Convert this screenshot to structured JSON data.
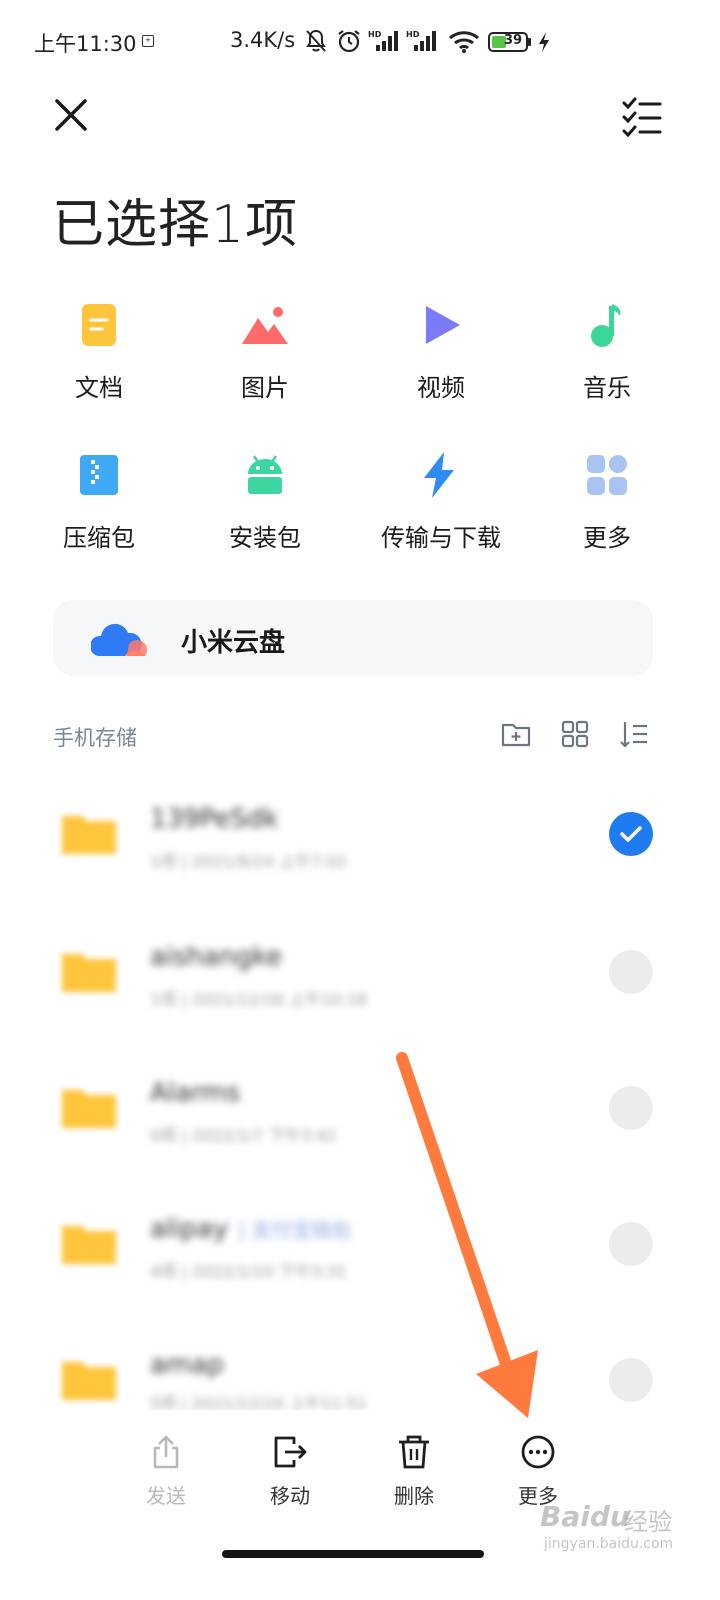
{
  "status_bar": {
    "time": "上午11:30",
    "net_speed": "3.4K/s",
    "battery": "39"
  },
  "header": {
    "title": "已选择1项"
  },
  "categories": [
    {
      "label": "文档",
      "icon": "document-icon",
      "color": "#FFC53D"
    },
    {
      "label": "图片",
      "icon": "image-icon",
      "color": "#FF6B6B"
    },
    {
      "label": "视频",
      "icon": "video-play-icon",
      "color": "#7B7BF7"
    },
    {
      "label": "音乐",
      "icon": "music-note-icon",
      "color": "#3DD598"
    },
    {
      "label": "压缩包",
      "icon": "zip-icon",
      "color": "#3FA9F5"
    },
    {
      "label": "安装包",
      "icon": "android-icon",
      "color": "#3DD5A0"
    },
    {
      "label": "传输与下载",
      "icon": "transfer-icon",
      "color": "#2F8BF5"
    },
    {
      "label": "更多",
      "icon": "grid-icon",
      "color": "#A9C3F2"
    }
  ],
  "cloud": {
    "label": "小米云盘",
    "icon": "cloud-icon"
  },
  "storage": {
    "header": "手机存储",
    "icons": [
      "new-folder-icon",
      "grid-view-icon",
      "sort-icon"
    ]
  },
  "files": [
    {
      "name": "139PeSdk",
      "meta": "1项 | 2021/8/24 上午7:02",
      "tag": "",
      "selected": true
    },
    {
      "name": "aishangke",
      "meta": "1项 | 2021/12/16 上午10:18",
      "tag": "",
      "selected": false
    },
    {
      "name": "Alarms",
      "meta": "0项 | 2022/1/7 下午3:42",
      "tag": "",
      "selected": false
    },
    {
      "name": "alipay",
      "meta": "4项 | 2022/1/10 下午3:31",
      "tag": "| 支付宝钱包",
      "selected": false
    },
    {
      "name": "amap",
      "meta": "5项 | 2021/12/24 上午11:51",
      "tag": "",
      "selected": false
    }
  ],
  "bottom_bar": {
    "send": "发送",
    "move": "移动",
    "delete": "删除",
    "more": "更多"
  },
  "watermark": {
    "brand": "Baidu",
    "brand_cn": "经验",
    "url": "jingyan.baidu.com"
  },
  "colors": {
    "accent": "#1E7BF0",
    "annotation_arrow": "#FF7A3D"
  }
}
